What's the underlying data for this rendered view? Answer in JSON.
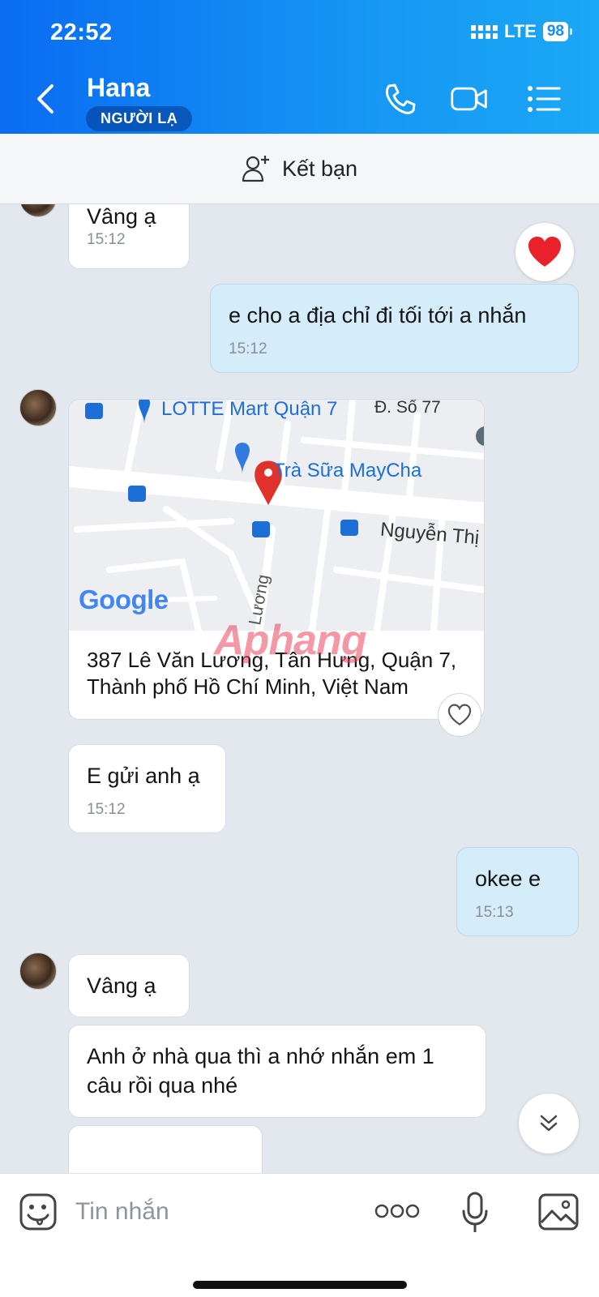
{
  "status": {
    "time": "22:52",
    "network": "LTE",
    "battery": "98"
  },
  "header": {
    "contact_name": "Hana",
    "badge": "NGƯỜI LẠ"
  },
  "friend_bar": {
    "label": "Kết bạn"
  },
  "messages": [
    {
      "direction": "in",
      "text": "Vâng ạ",
      "time": "15:12",
      "reaction": "heart"
    },
    {
      "direction": "out",
      "text": "e cho a địa chỉ đi tối tới a nhắn",
      "time": "15:12"
    },
    {
      "direction": "in",
      "type": "location",
      "address": "387 Lê Văn Lương, Tân Hưng, Quận 7, Thành phố Hồ Chí Minh, Việt Nam",
      "map_labels": {
        "lotte": "LOTTE Mart Quận 7",
        "road1": "Đ. Số 77",
        "shop": "Trà Sữa MayCha",
        "road2": "Nguyễn Thị",
        "road3": "Lương",
        "logo": "Google"
      }
    },
    {
      "direction": "in",
      "text": "E gửi anh ạ",
      "time": "15:12"
    },
    {
      "direction": "out",
      "text": "okee e",
      "time": "15:13"
    },
    {
      "direction": "in",
      "text": "Vâng ạ"
    },
    {
      "direction": "in",
      "text": "Anh ở nhà qua thì a nhớ nhắn em 1 câu rồi qua nhé"
    }
  ],
  "watermark": "Aphang",
  "input": {
    "placeholder": "Tin nhắn"
  },
  "colors": {
    "header": "#1596f4",
    "outgoing_bubble": "#d5ecfb",
    "chat_bg": "#e3e8ee",
    "heart": "#e8212b"
  }
}
